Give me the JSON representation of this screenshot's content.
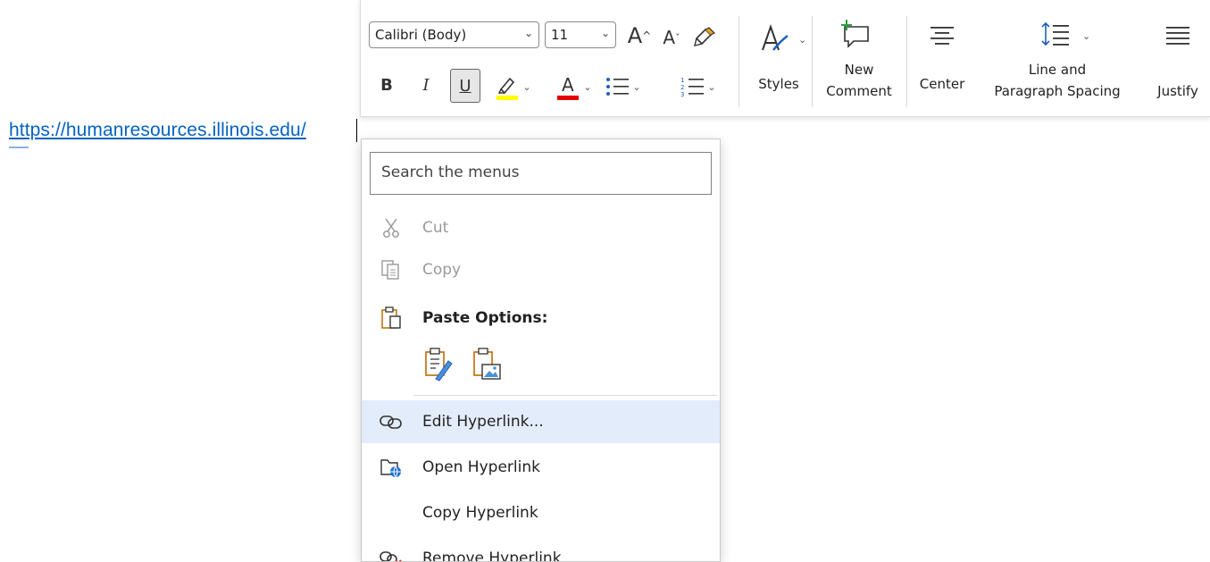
{
  "document": {
    "link_text": "https://humanresources.illinois.edu/"
  },
  "ribbon": {
    "font_name": "Calibri (Body)",
    "font_size": "11",
    "grow_font": "A",
    "shrink_font": "A",
    "bold": "B",
    "italic": "I",
    "underline": "U",
    "font_color_glyph": "A",
    "styles_label": "Styles",
    "new_comment_line1": "New",
    "new_comment_line2": "Comment",
    "center_label": "Center",
    "spacing_line1": "Line and",
    "spacing_line2": "Paragraph Spacing",
    "justify_label": "Justify",
    "highlight_color": "#ffff00",
    "font_color": "#e00000"
  },
  "context_menu": {
    "search_placeholder": "Search the menus",
    "items": [
      {
        "label": "Cut",
        "icon": "scissors-icon",
        "enabled": false
      },
      {
        "label": "Copy",
        "icon": "copy-icon",
        "enabled": false
      },
      {
        "label": "Paste Options:",
        "icon": "clipboard-icon",
        "enabled": true
      },
      {
        "label": "Edit Hyperlink...",
        "icon": "link-icon",
        "enabled": true
      },
      {
        "label": "Open Hyperlink",
        "icon": "open-hyperlink-icon",
        "enabled": true
      },
      {
        "label": "Copy Hyperlink",
        "icon": "",
        "enabled": true
      },
      {
        "label": "Remove Hyperlink",
        "icon": "remove-link-icon",
        "enabled": true
      }
    ],
    "paste_options": [
      "keep-source-formatting-icon",
      "picture-icon"
    ]
  }
}
